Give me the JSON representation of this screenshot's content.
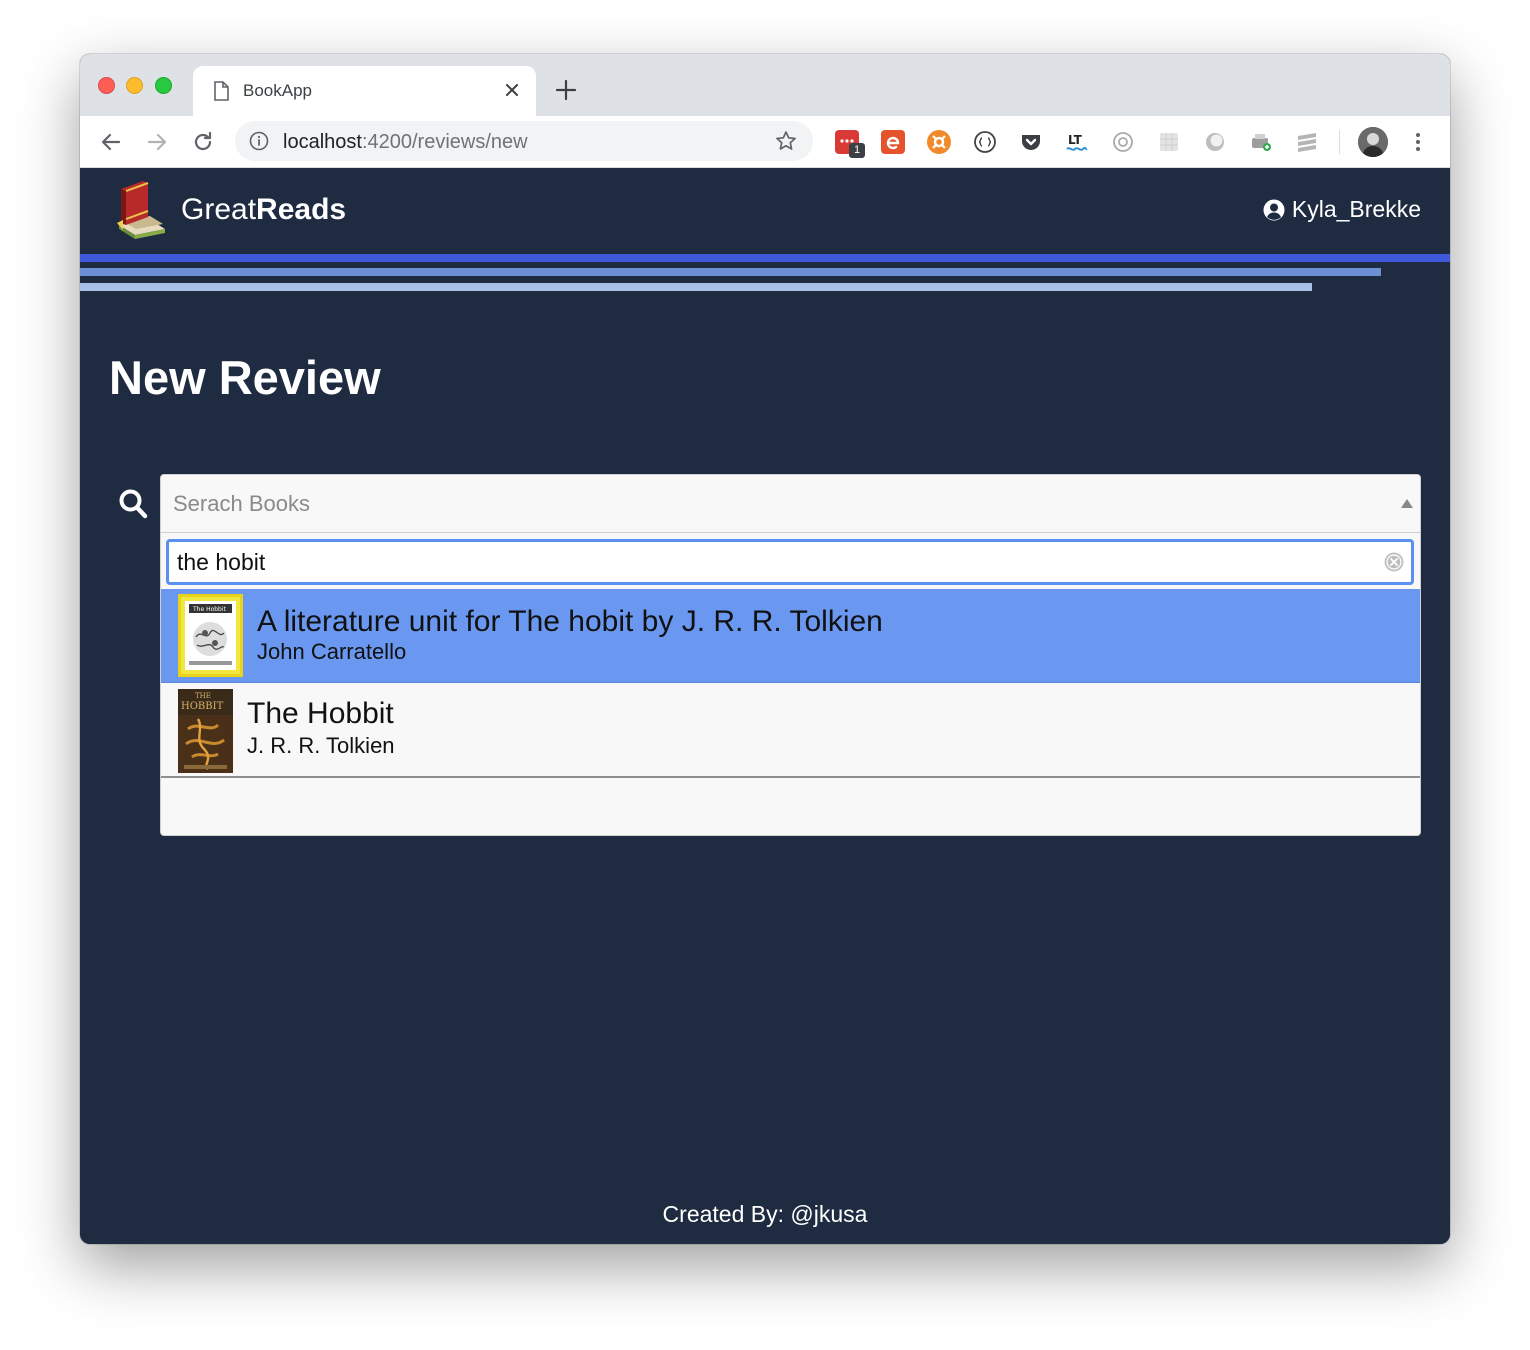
{
  "browser": {
    "tab_title": "BookApp",
    "url_host": "localhost",
    "url_path": ":4200/reviews/new",
    "extension_badge": "1"
  },
  "app": {
    "brand_regular": "Great",
    "brand_bold": "Reads",
    "username": "Kyla_Brekke",
    "page_title": "New Review",
    "search": {
      "placeholder": "Serach Books",
      "query": "the hobit"
    },
    "results": [
      {
        "title": "A literature unit for The hobit by J. R. R. Tolkien",
        "author": "John Carratello",
        "highlighted": true
      },
      {
        "title": "The Hobbit",
        "author": "J. R. R. Tolkien",
        "highlighted": false
      }
    ],
    "footer": "Created By: @jkusa"
  },
  "colors": {
    "app_background": "#1e2b40",
    "stripe_1": "#4058db",
    "stripe_2": "#6b90d3",
    "stripe_3": "#a8c0e6",
    "highlight": "#6a98f0",
    "focus_ring": "#5b8ff0"
  }
}
